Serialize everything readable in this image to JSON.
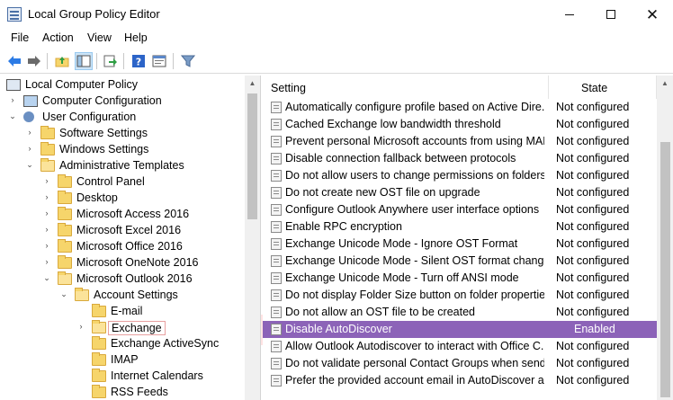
{
  "window": {
    "title": "Local Group Policy Editor"
  },
  "menu": {
    "file": "File",
    "action": "Action",
    "view": "View",
    "help": "Help"
  },
  "toolbar": {
    "icons": [
      "back-arrow-icon",
      "forward-arrow-icon",
      "up-folder-icon",
      "show-hide-tree-icon",
      "export-list-icon",
      "help-icon",
      "properties-icon",
      "filter-icon"
    ]
  },
  "tree": {
    "root": "Local Computer Policy",
    "computer_config": "Computer Configuration",
    "user_config": "User Configuration",
    "software_settings": "Software Settings",
    "windows_settings": "Windows Settings",
    "admin_templates": "Administrative Templates",
    "control_panel": "Control Panel",
    "desktop": "Desktop",
    "access": "Microsoft Access 2016",
    "excel": "Microsoft Excel 2016",
    "office": "Microsoft Office 2016",
    "onenote": "Microsoft OneNote 2016",
    "outlook": "Microsoft Outlook 2016",
    "account_settings": "Account Settings",
    "email": "E-mail",
    "exchange": "Exchange",
    "exchange_activesync": "Exchange ActiveSync",
    "imap": "IMAP",
    "internet_calendars": "Internet Calendars",
    "rss_feeds": "RSS Feeds"
  },
  "policies": {
    "header_setting": "Setting",
    "header_state": "State",
    "rows": [
      {
        "name": "Automatically configure profile based on Active Dire...",
        "state": "Not configured"
      },
      {
        "name": "Cached Exchange low bandwidth threshold",
        "state": "Not configured"
      },
      {
        "name": "Prevent personal Microsoft accounts from using MAPI",
        "state": "Not configured"
      },
      {
        "name": "Disable connection fallback between protocols",
        "state": "Not configured"
      },
      {
        "name": "Do not allow users to change permissions on folders",
        "state": "Not configured"
      },
      {
        "name": "Do not create new OST file on upgrade",
        "state": "Not configured"
      },
      {
        "name": "Configure Outlook Anywhere user interface options",
        "state": "Not configured"
      },
      {
        "name": "Enable RPC encryption",
        "state": "Not configured"
      },
      {
        "name": "Exchange Unicode Mode - Ignore OST Format",
        "state": "Not configured"
      },
      {
        "name": "Exchange Unicode Mode - Silent OST format change",
        "state": "Not configured"
      },
      {
        "name": "Exchange Unicode Mode - Turn off ANSI mode",
        "state": "Not configured"
      },
      {
        "name": "Do not display Folder Size button on folder properties...",
        "state": "Not configured"
      },
      {
        "name": "Do not allow an OST file to be created",
        "state": "Not configured"
      },
      {
        "name": "Disable AutoDiscover",
        "state": "Enabled"
      },
      {
        "name": "Allow Outlook Autodiscover to interact with Office C...",
        "state": "Not configured"
      },
      {
        "name": "Do not validate personal Contact Groups when sendi...",
        "state": "Not configured"
      },
      {
        "name": "Prefer the provided account email in AutoDiscover a...",
        "state": "Not configured"
      }
    ]
  },
  "colors": {
    "selection": "#8c63b8",
    "highlight_band": "#ff6363"
  }
}
